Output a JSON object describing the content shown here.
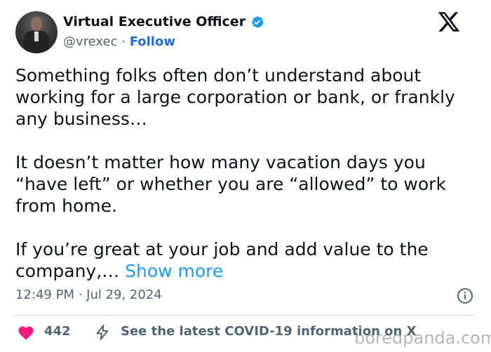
{
  "author": {
    "name": "Virtual Executive Officer",
    "handle": "@vrexec",
    "separator": "·",
    "follow_label": "Follow",
    "verified_icon": "verified-badge-icon",
    "avatar_icon": "profile-photo"
  },
  "brand_icon": "x-logo-icon",
  "tweet": {
    "paragraphs": [
      "Something folks often don’t understand about working for a large corporation or bank, or frankly any business…",
      "It doesn’t matter how many vacation days you “have left” or whether you are “allowed” to work from home.",
      "If you’re great at your job and add value to the company,…"
    ],
    "show_more_label": "Show more"
  },
  "timestamp": "12:49 PM · Jul 29, 2024",
  "info_icon": "info-icon",
  "footer": {
    "likes": "442",
    "like_icon": "heart-icon",
    "covid_icon": "bolt-icon",
    "covid_text": "See the latest COVID-19 information on X"
  },
  "watermark": "boredpanda.com",
  "colors": {
    "accent": "#1d9bf0",
    "follow": "#1d6fd6",
    "verified": "#1d9bf0",
    "like": "#f91880",
    "text": "#0f1419",
    "secondary": "#536471"
  }
}
